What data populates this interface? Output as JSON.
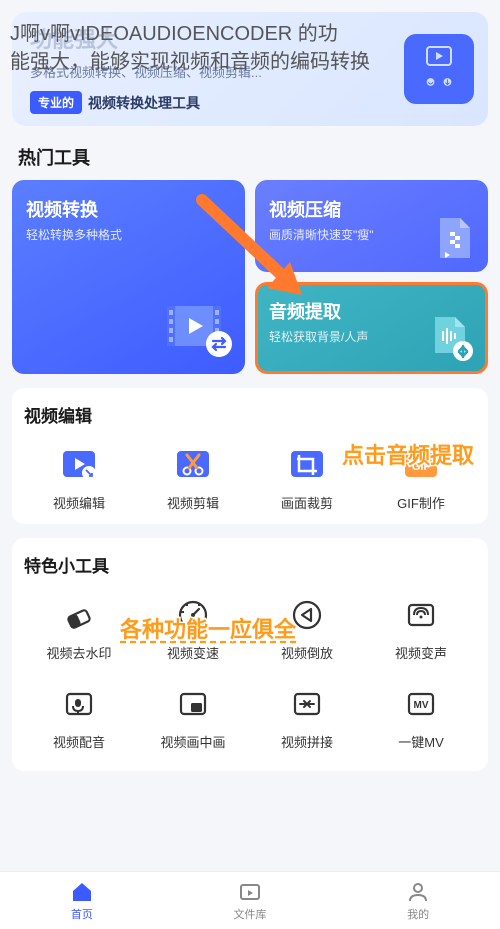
{
  "overlay": {
    "line1": "J啊v啊vIDEOAUDIOENCODER 的功",
    "line2": "能强大，能够实现视频和音频的编码转换"
  },
  "hero": {
    "title_faded": "功能强大",
    "sub": "多格式视频转换、视频压缩、视频剪辑...",
    "badge": "专业的",
    "badge_text": "视频转换处理工具"
  },
  "sections": {
    "hot": "热门工具",
    "video_edit": "视频编辑",
    "special": "特色小工具"
  },
  "hot_cards": {
    "convert": {
      "title": "视频转换",
      "sub": "轻松转换多种格式"
    },
    "compress": {
      "title": "视频压缩",
      "sub": "画质清晰快速变\"瘦\""
    },
    "audio": {
      "title": "音频提取",
      "sub": "轻松获取背景/人声"
    }
  },
  "annotations": {
    "click_audio": "点击音频提取",
    "all_features": "各种功能一应俱全"
  },
  "video_edit_tools": [
    {
      "label": "视频编辑",
      "icon": "edit-video-icon",
      "color": "#4a6aff"
    },
    {
      "label": "视频剪辑",
      "icon": "scissors-icon",
      "color": "#4a6aff"
    },
    {
      "label": "画面裁剪",
      "icon": "crop-icon",
      "color": "#4a6aff"
    },
    {
      "label": "GIF制作",
      "icon": "gif-icon",
      "color": "#ff9a3e"
    }
  ],
  "special_tools": [
    {
      "label": "视频去水印",
      "icon": "eraser-icon"
    },
    {
      "label": "视频变速",
      "icon": "speed-icon"
    },
    {
      "label": "视频倒放",
      "icon": "reverse-icon"
    },
    {
      "label": "视频变声",
      "icon": "voice-icon"
    },
    {
      "label": "视频配音",
      "icon": "dub-icon"
    },
    {
      "label": "视频画中画",
      "icon": "pip-icon"
    },
    {
      "label": "视频拼接",
      "icon": "merge-icon"
    },
    {
      "label": "一键MV",
      "icon": "mv-icon"
    }
  ],
  "nav": {
    "home": "首页",
    "files": "文件库",
    "mine": "我的"
  }
}
